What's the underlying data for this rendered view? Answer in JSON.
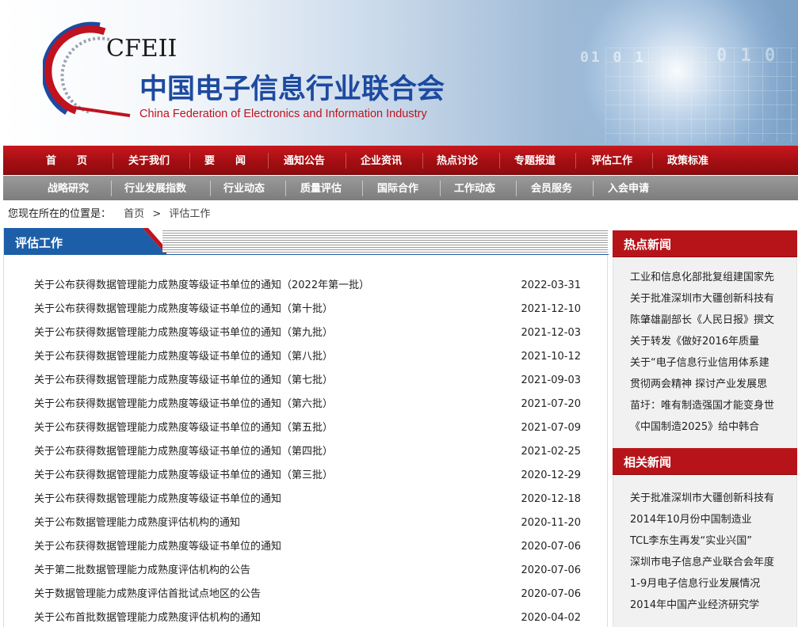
{
  "site": {
    "abbr": "CFEII",
    "name_cn": "中国电子信息行业联合会",
    "name_en": "China Federation of Electronics and Information Industry",
    "colors": {
      "brand_red": "#b7141a",
      "brand_blue": "#1d4aa0",
      "nav_grey": "#8a8a8a"
    }
  },
  "nav_primary": [
    "首　　页",
    "关于我们",
    "要　　闻",
    "通知公告",
    "企业资讯",
    "热点讨论",
    "专题报道",
    "评估工作",
    "政策标准"
  ],
  "nav_secondary": [
    "战略研究",
    "行业发展指数",
    "行业动态",
    "质量评估",
    "国际合作",
    "工作动态",
    "会员服务",
    "入会申请"
  ],
  "breadcrumb": {
    "prefix": "您现在所在的位置是：",
    "home": "首页",
    "separator": ">",
    "current": "评估工作"
  },
  "main": {
    "title": "评估工作",
    "items": [
      {
        "title": "关于公布获得数据管理能力成熟度等级证书单位的通知（2022年第一批）",
        "date": "2022-03-31"
      },
      {
        "title": "关于公布获得数据管理能力成熟度等级证书单位的通知（第十批）",
        "date": "2021-12-10"
      },
      {
        "title": "关于公布获得数据管理能力成熟度等级证书单位的通知（第九批）",
        "date": "2021-12-03"
      },
      {
        "title": "关于公布获得数据管理能力成熟度等级证书单位的通知（第八批）",
        "date": "2021-10-12"
      },
      {
        "title": "关于公布获得数据管理能力成熟度等级证书单位的通知（第七批）",
        "date": "2021-09-03"
      },
      {
        "title": "关于公布获得数据管理能力成熟度等级证书单位的通知（第六批）",
        "date": "2021-07-20"
      },
      {
        "title": "关于公布获得数据管理能力成熟度等级证书单位的通知（第五批）",
        "date": "2021-07-09"
      },
      {
        "title": "关于公布获得数据管理能力成熟度等级证书单位的通知（第四批）",
        "date": "2021-02-25"
      },
      {
        "title": "关于公布获得数据管理能力成熟度等级证书单位的通知（第三批）",
        "date": "2020-12-29"
      },
      {
        "title": "关于公布获得数据管理能力成熟度等级证书单位的通知",
        "date": "2020-12-18"
      },
      {
        "title": "关于公布数据管理能力成熟度评估机构的通知",
        "date": "2020-11-20"
      },
      {
        "title": "关于公布获得数据管理能力成熟度等级证书单位的通知",
        "date": "2020-07-06"
      },
      {
        "title": "关于第二批数据管理能力成熟度评估机构的公告",
        "date": "2020-07-06"
      },
      {
        "title": "关于数据管理能力成熟度评估首批试点地区的公告",
        "date": "2020-07-06"
      },
      {
        "title": "关于公布首批数据管理能力成熟度评估机构的通知",
        "date": "2020-04-02"
      }
    ]
  },
  "sidebar": {
    "hot": {
      "title": "热点新闻",
      "items": [
        "工业和信息化部批复组建国家先",
        "关于批准深圳市大疆创新科技有",
        "陈肇雄副部长《人民日报》撰文",
        "关于转发《做好2016年质量",
        "关于“电子信息行业信用体系建",
        "贯彻两会精神 探讨产业发展思",
        "苗圩：唯有制造强国才能变身世",
        "《中国制造2025》给中韩合"
      ]
    },
    "related": {
      "title": "相关新闻",
      "items": [
        "关于批准深圳市大疆创新科技有",
        "2014年10月份中国制造业",
        "TCL李东生再发“实业兴国”",
        "深圳市电子信息产业联合会年度",
        "1-9月电子信息行业发展情况",
        "2014年中国产业经济研究学"
      ]
    }
  }
}
